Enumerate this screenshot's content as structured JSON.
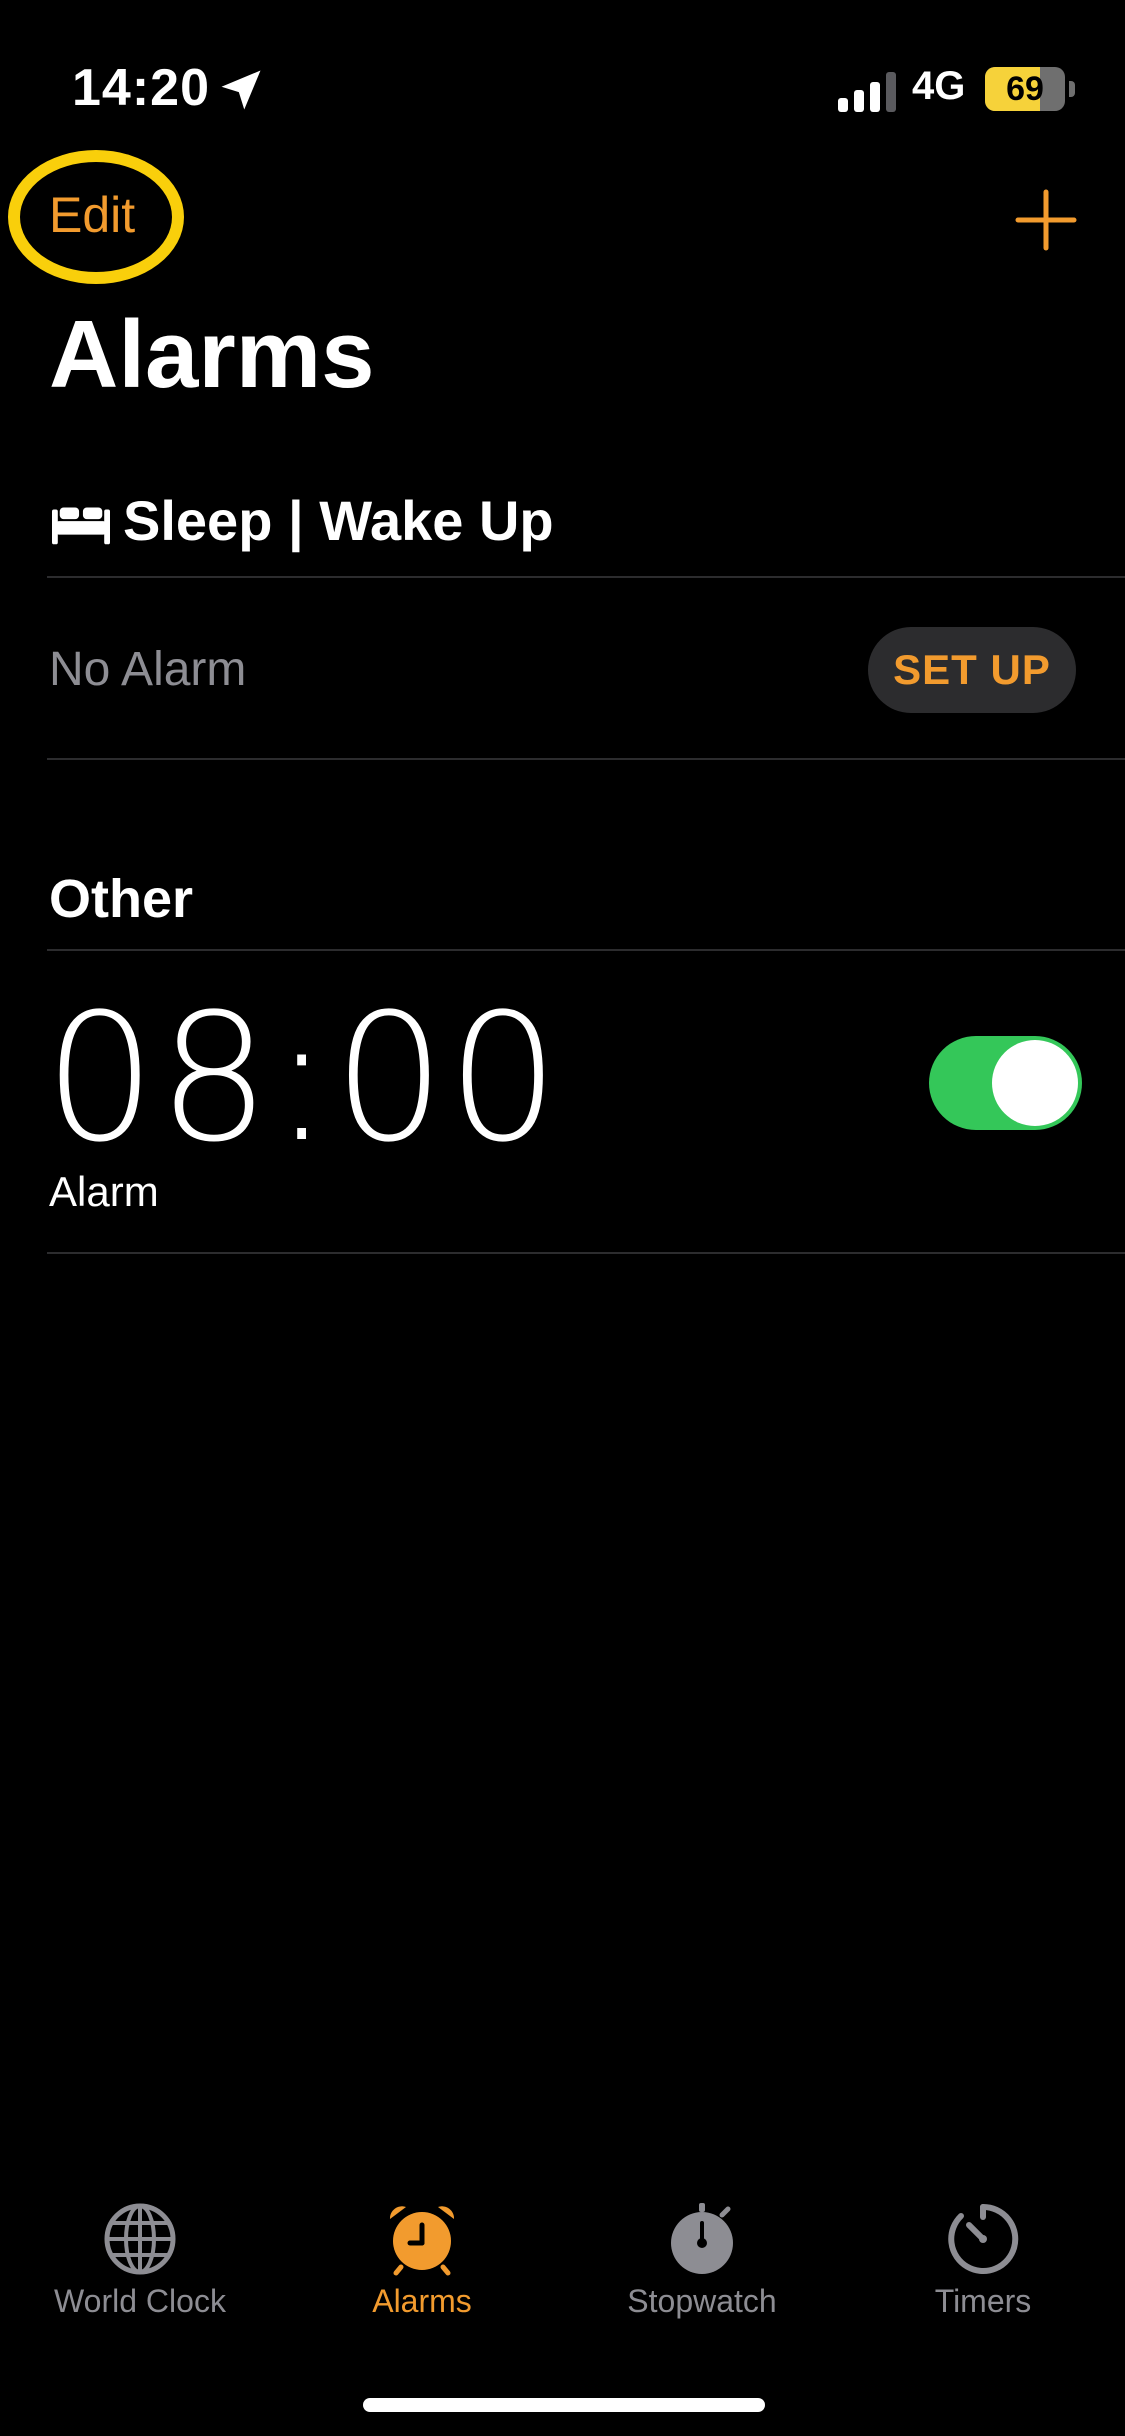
{
  "status_bar": {
    "time": "14:20",
    "network": "4G",
    "battery_level": "69",
    "battery_fraction": 0.69
  },
  "nav": {
    "edit_label": "Edit",
    "title": "Alarms"
  },
  "sleep_section": {
    "title": "Sleep | Wake Up",
    "no_alarm": "No Alarm",
    "setup_label": "SET UP"
  },
  "other_section": {
    "title": "Other",
    "alarms": [
      {
        "time": "08:00",
        "label": "Alarm",
        "enabled": true
      }
    ]
  },
  "tabs": [
    {
      "label": "World Clock",
      "icon": "globe-icon",
      "active": false
    },
    {
      "label": "Alarms",
      "icon": "alarm-clock-icon",
      "active": true
    },
    {
      "label": "Stopwatch",
      "icon": "stopwatch-icon",
      "active": false
    },
    {
      "label": "Timers",
      "icon": "timer-icon",
      "active": false
    }
  ],
  "colors": {
    "accent": "#f29b2e",
    "toggle_on": "#34c759",
    "highlight": "#f9cf0b",
    "battery": "#f6d23a"
  }
}
